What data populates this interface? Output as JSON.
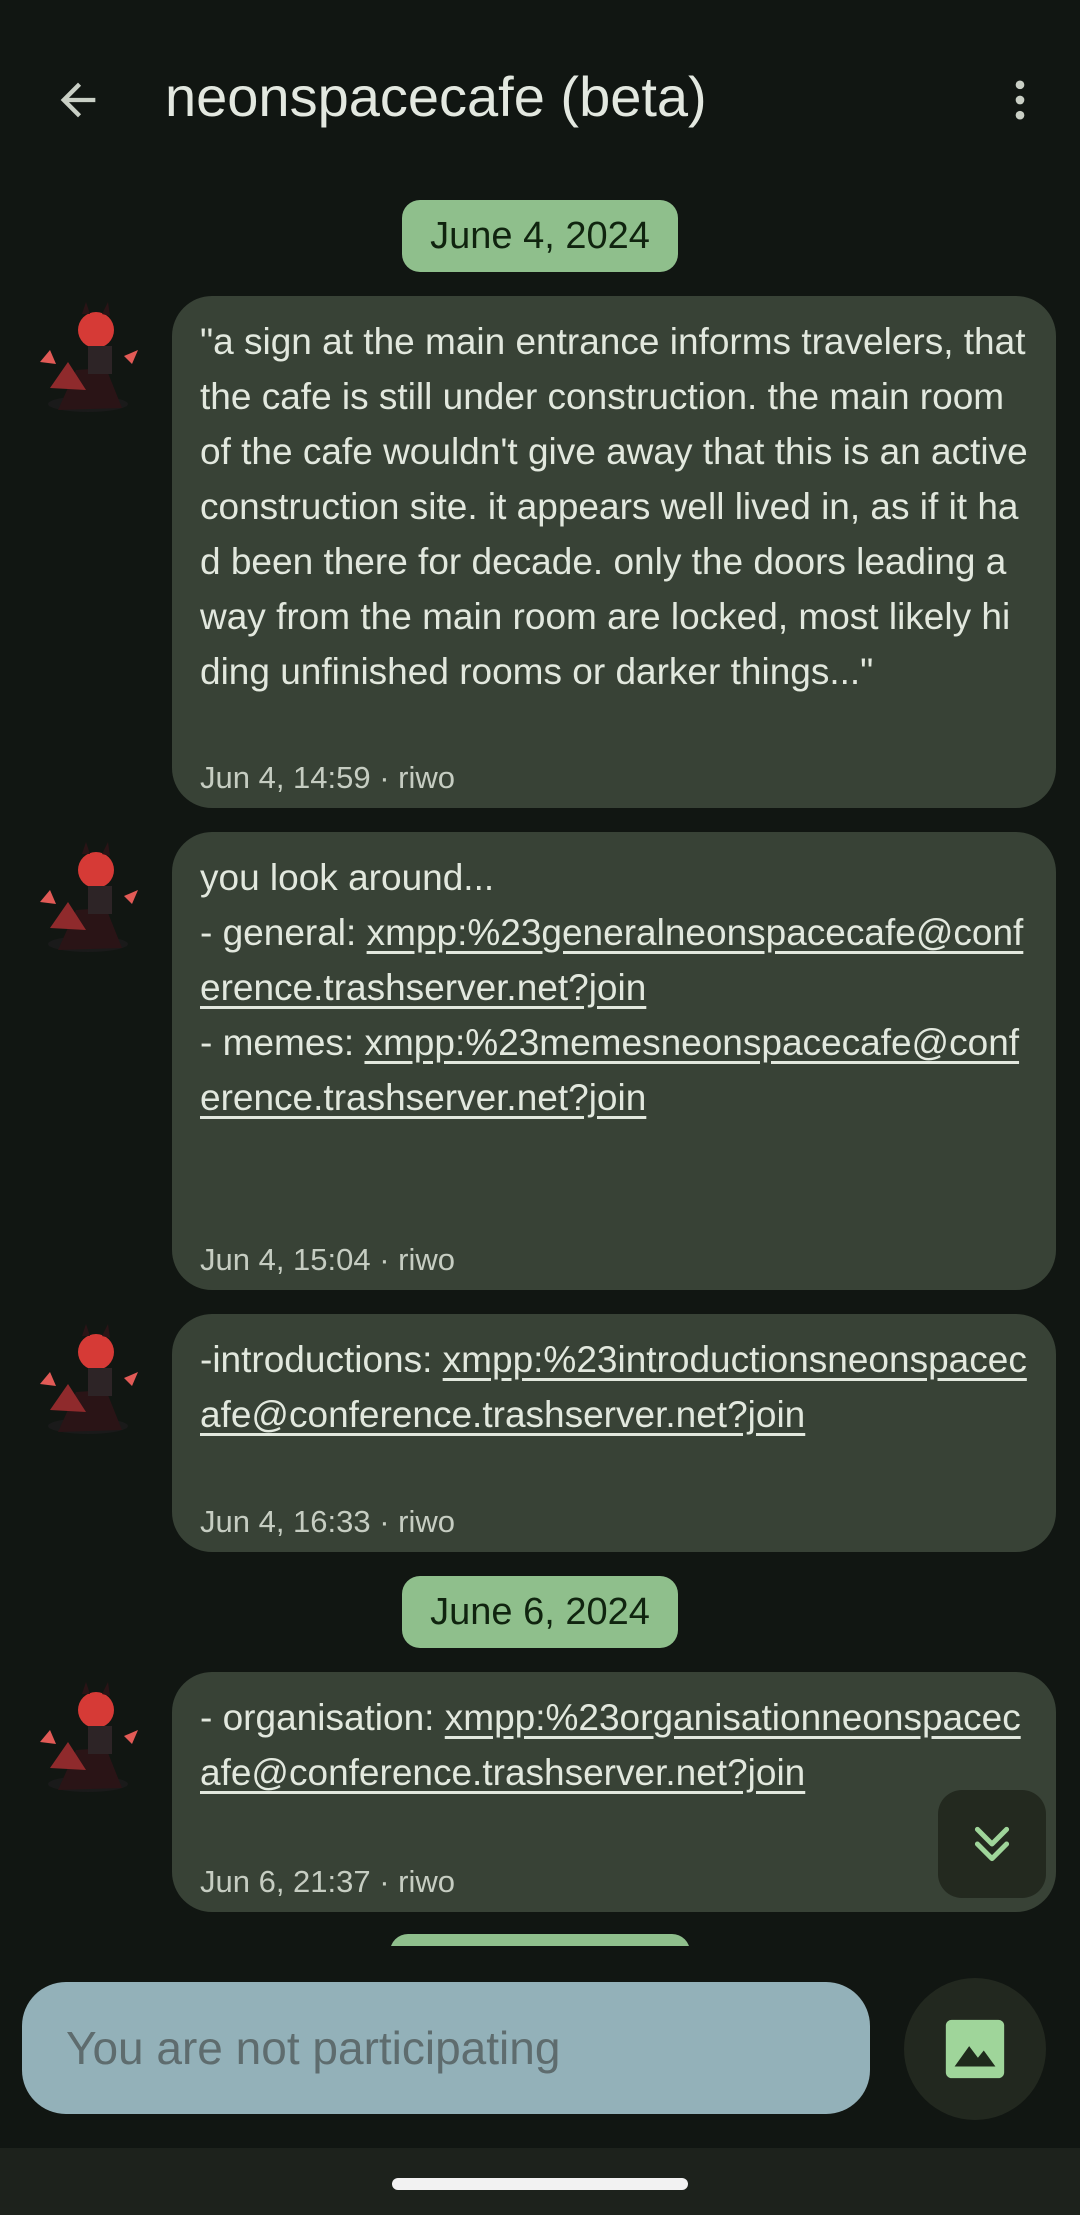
{
  "header": {
    "title": "neonspacecafe (beta)",
    "back_icon": "arrow-back-icon",
    "more_icon": "more-vert-icon"
  },
  "date_separators": [
    "June 4, 2024",
    "June 6, 2024"
  ],
  "messages": [
    {
      "text": "\"a sign at the main entrance informs travelers, that the cafe is still under construction. the main room of the cafe wouldn't give away that this is an active construction site. it appears well lived in, as if it had been there for decade. only the doors leading away from the main room are locked, most likely hiding unfinished rooms or darker things...\"",
      "meta": "Jun 4, 14:59 · riwo"
    },
    {
      "line1": "you look around...",
      "label_general": "- general: ",
      "link_general": "xmpp:%23generalneonspacecafe@conference.trashserver.net?join",
      "label_memes": "- memes: ",
      "link_memes": "xmpp:%23memesneonspacecafe@conference.trashserver.net?join",
      "meta": "Jun 4, 15:04 · riwo"
    },
    {
      "label": "-introductions: ",
      "link": "xmpp:%23introductionsneonspacecafe@conference.trashserver.net?join",
      "meta": "Jun 4, 16:33 · riwo"
    },
    {
      "label": "- organisation: ",
      "link": "xmpp:%23organisationneonspacecafe@conference.trashserver.net?join",
      "meta": "Jun 6, 21:37 · riwo"
    }
  ],
  "composer": {
    "placeholder": "You are not participating",
    "attach_icon": "image-icon"
  },
  "scroll_fab_icon": "double-chevron-down-icon",
  "colors": {
    "background": "#111612",
    "bubble": "#384236",
    "date_chip": "#8fbf8c",
    "input": "#93b1b9"
  }
}
